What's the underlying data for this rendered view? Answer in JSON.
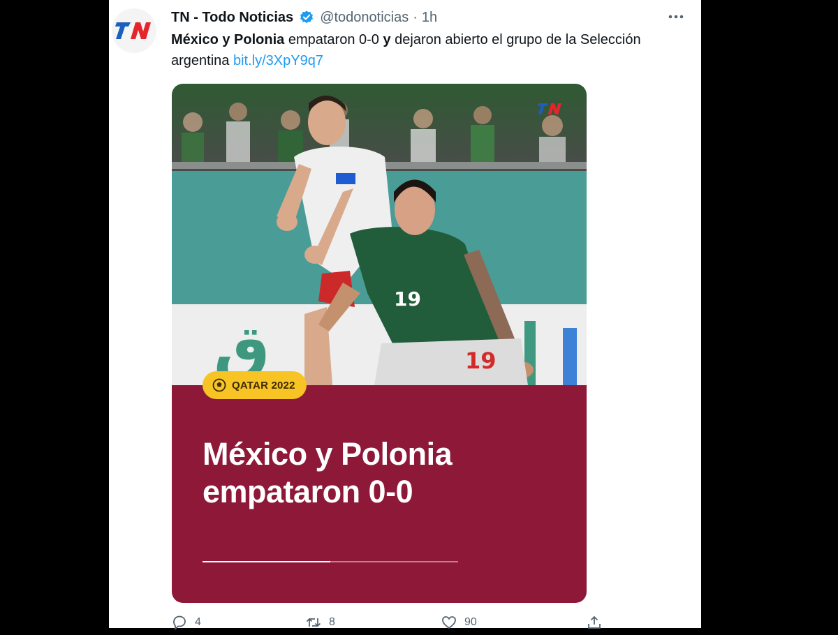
{
  "tweet": {
    "author_name": "TN - Todo Noticias",
    "handle": "@todonoticias",
    "separator": "·",
    "time": "1h",
    "text_bold_1": "México y Polonia",
    "text_1": " empataron 0-0 ",
    "text_bold_2": "y",
    "text_2": " dejaron abierto el grupo de la Selección argentina ",
    "link": "bit.ly/3XpY9q7"
  },
  "media": {
    "badge_label": "QATAR 2022",
    "headline_line1": "México y Polonia",
    "headline_line2": "empataron 0-0",
    "progress": 0.5,
    "jersey_front": "19",
    "jersey_back": "19"
  },
  "actions": {
    "reply_count": "4",
    "retweet_count": "8",
    "like_count": "90"
  },
  "icons": {
    "avatar": "tn-logo-icon",
    "verified": "verified-badge-icon",
    "more": "more-options-icon",
    "badge": "soccer-ball-icon",
    "reply": "reply-icon",
    "retweet": "retweet-icon",
    "like": "heart-icon",
    "share": "share-icon"
  },
  "colors": {
    "brand_blue": "#1d9bf0",
    "panel_maroon": "#8e1838",
    "badge_yellow": "#f7c325",
    "tn_red": "#e4252b",
    "tn_blue": "#1a5fbe"
  }
}
